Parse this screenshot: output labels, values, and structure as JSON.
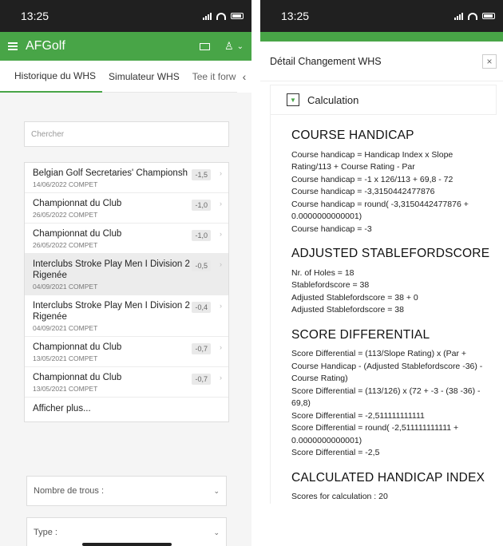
{
  "left": {
    "status_time": "13:25",
    "app_title": "AFGolf",
    "tabs": [
      "Historique du WHS",
      "Simulateur WHS",
      "Tee it forw"
    ],
    "search_placeholder": "Chercher",
    "rows": [
      {
        "name": "Belgian Golf Secretaries' Championsh",
        "sub": "",
        "meta": "14/06/2022 COMPET",
        "value": "-1,5"
      },
      {
        "name": "Championnat du Club",
        "sub": "",
        "meta": "26/05/2022 COMPET",
        "value": "-1,0"
      },
      {
        "name": "Championnat du Club",
        "sub": "",
        "meta": "26/05/2022 COMPET",
        "value": "-1,0"
      },
      {
        "name": "Interclubs Stroke Play Men I Division 2",
        "sub": "Rigenée",
        "meta": "04/09/2021 COMPET",
        "value": "-0,5"
      },
      {
        "name": "Interclubs Stroke Play Men I Division 2",
        "sub": "Rigenée",
        "meta": "04/09/2021 COMPET",
        "value": "-0,4"
      },
      {
        "name": "Championnat du Club",
        "sub": "",
        "meta": "13/05/2021 COMPET",
        "value": "-0,7"
      },
      {
        "name": "Championnat du Club",
        "sub": "",
        "meta": "13/05/2021 COMPET",
        "value": "-0,7"
      }
    ],
    "more_label": "Afficher plus...",
    "dropdown_holes": "Nombre de trous :",
    "dropdown_type": "Type :"
  },
  "right": {
    "status_time": "13:25",
    "header_title": "Détail Changement WHS",
    "close_glyph": "×",
    "calc_label": "Calculation",
    "sections": [
      {
        "title": "COURSE HANDICAP",
        "lines": [
          "Course handicap = Handicap Index x Slope Rating/113 + Course Rating - Par",
          "Course handicap = -1 x 126/113 + 69,8 - 72",
          "Course handicap = -3,3150442477876",
          "Course handicap = round( -3,3150442477876 + 0.0000000000001)",
          "Course handicap = -3"
        ]
      },
      {
        "title": "ADJUSTED STABLEFORDSCORE",
        "lines": [
          "Nr. of Holes = 18",
          "Stablefordscore = 38",
          "Adjusted Stablefordscore = 38 + 0",
          "Adjusted Stablefordscore = 38"
        ]
      },
      {
        "title": "SCORE DIFFERENTIAL",
        "lines": [
          "Score Differential = (113/Slope Rating) x (Par + Course Handicap - (Adjusted Stablefordscore -36) - Course Rating)",
          "Score Differential = (113/126) x (72 + -3 - (38 -36) - 69,8)",
          "Score Differential = -2,511111111111",
          "Score Differential = round( -2,511111111111 + 0.0000000000001)",
          "Score Differential = -2,5"
        ]
      },
      {
        "title": "CALCULATED HANDICAP INDEX",
        "lines": [
          "Scores for calculation : 20"
        ]
      }
    ]
  }
}
